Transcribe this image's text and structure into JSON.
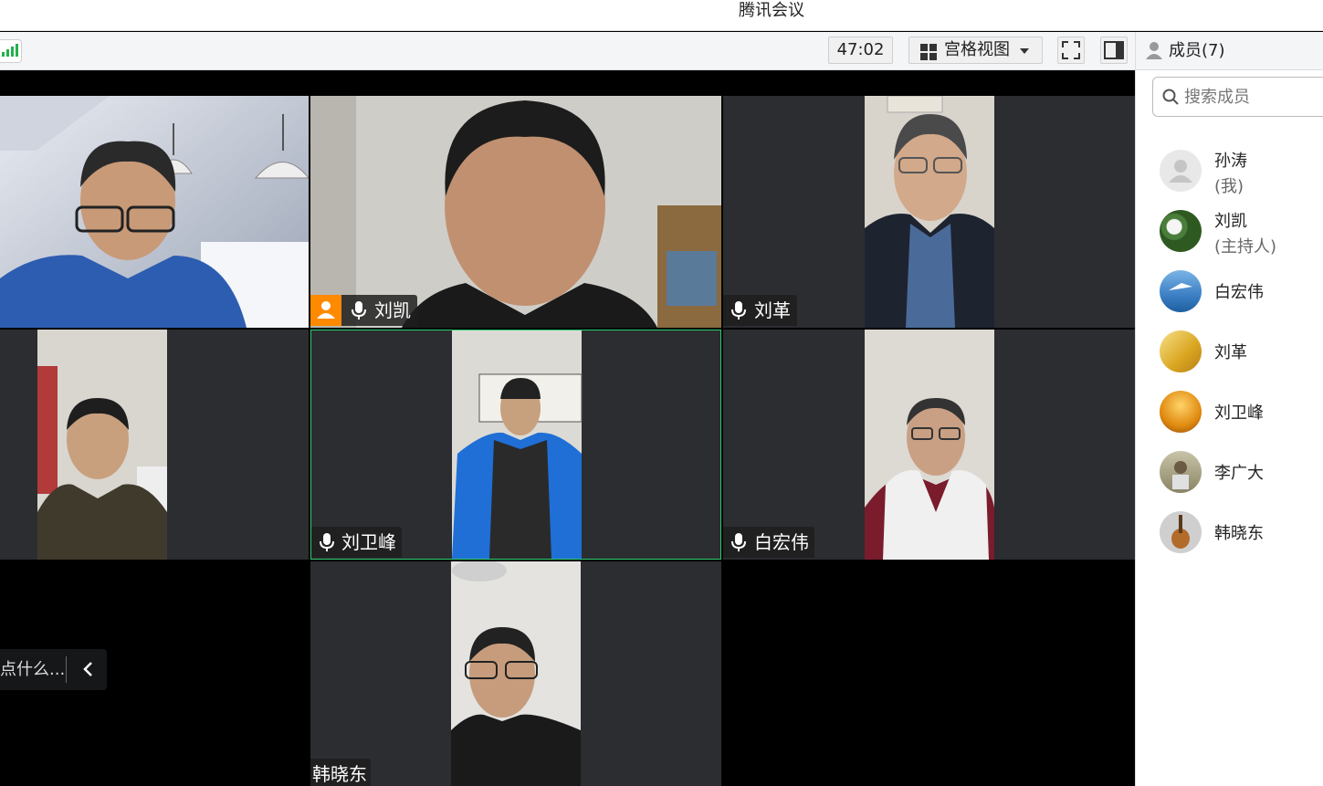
{
  "window": {
    "title": "腾讯会议"
  },
  "toolbar": {
    "timer": "47:02",
    "view_label": "宫格视图"
  },
  "sidebar": {
    "header_label": "成员(7)",
    "search_placeholder": "搜索成员",
    "members": [
      {
        "name": "孙涛",
        "role": "(我)"
      },
      {
        "name": "刘凯",
        "role": "(主持人)"
      },
      {
        "name": "白宏伟"
      },
      {
        "name": "刘革"
      },
      {
        "name": "刘卫峰"
      },
      {
        "name": "李广大"
      },
      {
        "name": "韩晓东"
      }
    ]
  },
  "video_tiles": [
    {
      "name": "刘凯",
      "host": true
    },
    {
      "name": "刘革"
    },
    {
      "name": "刘卫峰",
      "active_speaker": true
    },
    {
      "name": "白宏伟"
    },
    {
      "name": "韩晓东"
    }
  ],
  "chat_popup": {
    "text": "点什么..."
  },
  "colors": {
    "active_border": "#2ecc71",
    "host_badge": "#ff8a00",
    "signal": "#22b14c"
  }
}
